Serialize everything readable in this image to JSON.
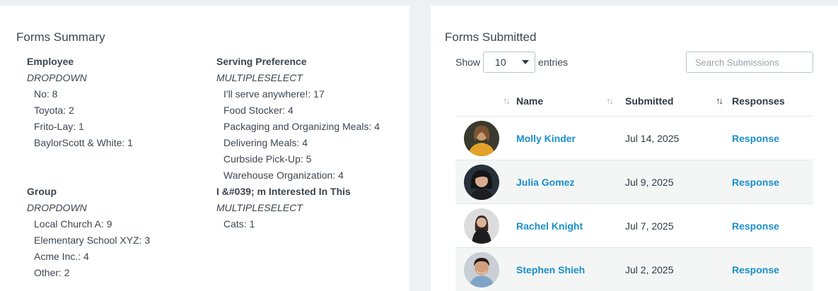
{
  "summary": {
    "title": "Forms Summary",
    "column1": [
      {
        "name": "Employee",
        "type": "DROPDOWN",
        "options": [
          "No: 8",
          "Toyota: 2",
          "Frito-Lay: 1",
          "BaylorScott & White: 1"
        ]
      },
      {
        "name": "Group",
        "type": "DROPDOWN",
        "options": [
          "Local Church A: 9",
          "Elementary School XYZ: 3",
          "Acme Inc.: 4",
          "Other: 2"
        ]
      }
    ],
    "column2": [
      {
        "name": "Serving Preference",
        "type": "MULTIPLESELECT",
        "options": [
          "I'll serve anywhere!: 17",
          "Food Stocker: 4",
          "Packaging and Organizing Meals: 4",
          "Delivering Meals: 4",
          "Curbside Pick-Up: 5",
          "Warehouse Organization: 4"
        ]
      },
      {
        "name": "I &#039; m Interested In This",
        "type": "MULTIPLESELECT",
        "options": [
          "Cats: 1"
        ]
      }
    ]
  },
  "submitted": {
    "title": "Forms Submitted",
    "show_label": "Show",
    "entries_value": "10",
    "entries_label": "entries",
    "search_placeholder": "Search Submissions",
    "columns": {
      "name": "Name",
      "submitted": "Submitted",
      "responses": "Responses"
    },
    "sort_icon": "↑↓",
    "rows": [
      {
        "name": "Molly Kinder",
        "date": "Jul 14, 2025",
        "response": "Response"
      },
      {
        "name": "Julia Gomez",
        "date": "Jul 9, 2025",
        "response": "Response"
      },
      {
        "name": "Rachel Knight",
        "date": "Jul 7, 2025",
        "response": "Response"
      },
      {
        "name": "Stephen Shieh",
        "date": "Jul 2, 2025",
        "response": "Response"
      }
    ]
  }
}
